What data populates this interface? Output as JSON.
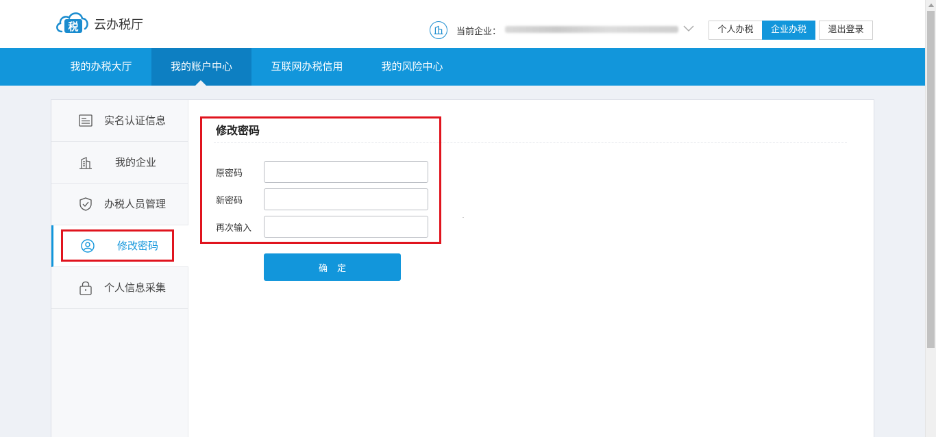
{
  "header": {
    "app_name": "云办税厅",
    "company_label": "当前企业：",
    "mode_tabs": [
      "个人办税",
      "企业办税"
    ],
    "active_mode": "企业办税",
    "logout_label": "退出登录"
  },
  "nav": {
    "items": [
      "我的办税大厅",
      "我的账户中心",
      "互联网办税信用",
      "我的风险中心"
    ],
    "active": "我的账户中心"
  },
  "sidebar": {
    "items": [
      {
        "label": "实名认证信息",
        "icon": "id-card-icon"
      },
      {
        "label": "我的企业",
        "icon": "building-icon"
      },
      {
        "label": "办税人员管理",
        "icon": "shield-check-icon"
      },
      {
        "label": "修改密码",
        "icon": "user-circle-icon"
      },
      {
        "label": "个人信息采集",
        "icon": "lock-icon"
      }
    ],
    "active": "修改密码"
  },
  "form": {
    "title": "修改密码",
    "fields": [
      {
        "label": "原密码",
        "value": ""
      },
      {
        "label": "新密码",
        "value": ""
      },
      {
        "label": "再次输入",
        "value": ""
      }
    ],
    "submit_label": "确定"
  },
  "colors": {
    "brand_blue": "#1296db",
    "nav_active": "#0d7fc2",
    "highlight_red": "#e0141e"
  }
}
